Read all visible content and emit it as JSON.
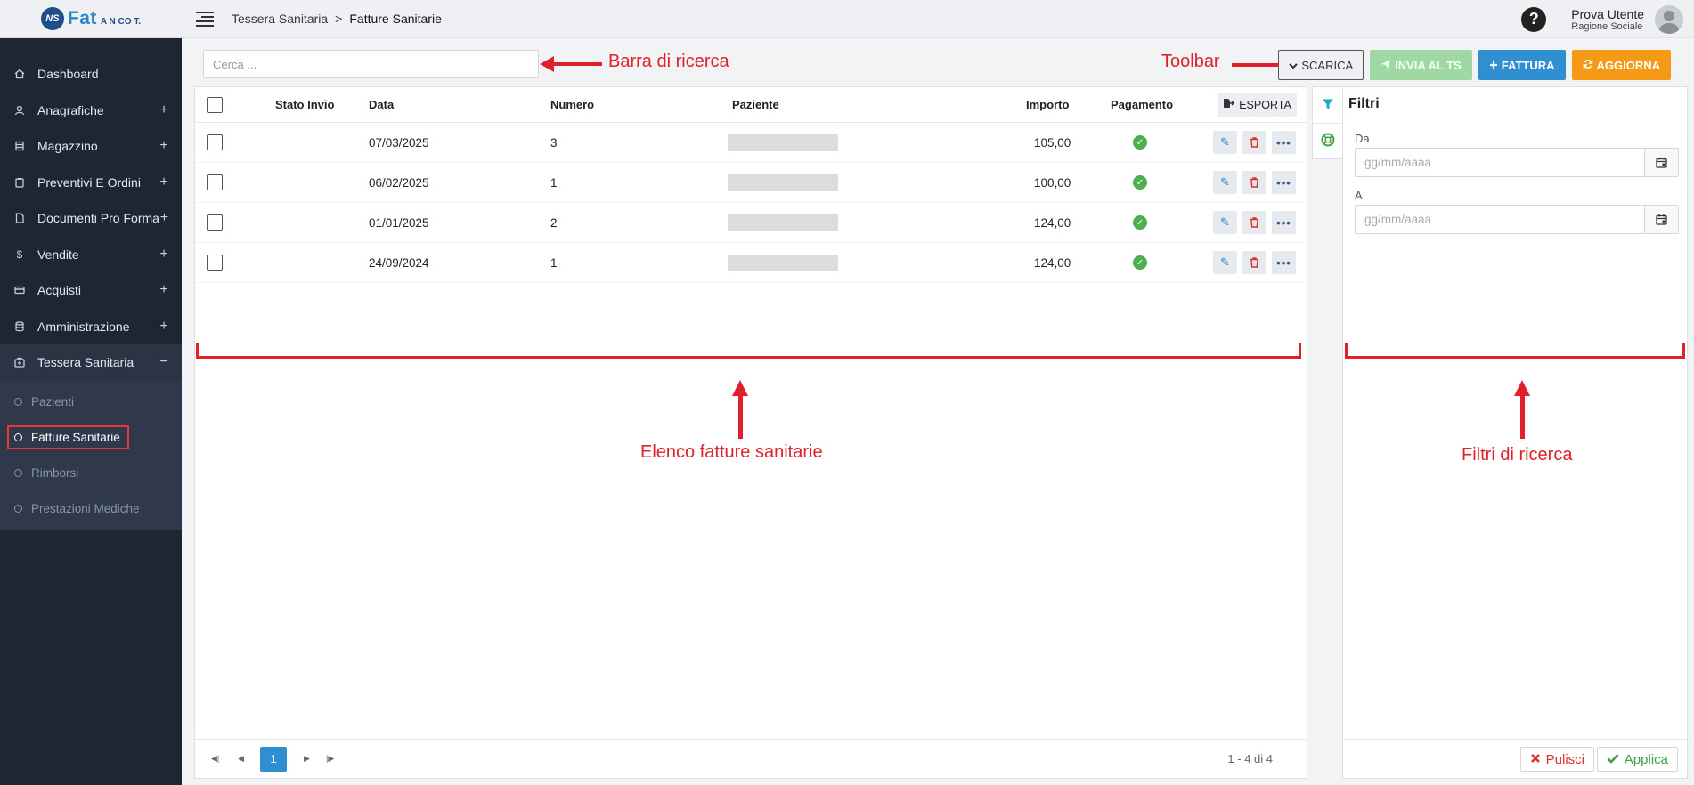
{
  "app": {
    "logo_prefix": "NS",
    "logo_main": "Fat",
    "logo_suffix": "A N CO T."
  },
  "sidebar": {
    "items": [
      {
        "label": "Dashboard",
        "icon": "home-icon",
        "expandable": false
      },
      {
        "label": "Anagrafiche",
        "icon": "user-icon",
        "expandable": true
      },
      {
        "label": "Magazzino",
        "icon": "warehouse-icon",
        "expandable": true
      },
      {
        "label": "Preventivi E Ordini",
        "icon": "clipboard-icon",
        "expandable": true
      },
      {
        "label": "Documenti Pro Forma",
        "icon": "document-icon",
        "expandable": true
      },
      {
        "label": "Vendite",
        "icon": "dollar-icon",
        "expandable": true
      },
      {
        "label": "Acquisti",
        "icon": "credit-card-icon",
        "expandable": true
      },
      {
        "label": "Amministrazione",
        "icon": "database-icon",
        "expandable": true
      },
      {
        "label": "Tessera Sanitaria",
        "icon": "medical-case-icon",
        "expandable": true,
        "expanded": true
      }
    ],
    "plus": "+",
    "minus": "−",
    "subitems": [
      {
        "label": "Pazienti"
      },
      {
        "label": "Fatture Sanitarie",
        "active": true
      },
      {
        "label": "Rimborsi"
      },
      {
        "label": "Prestazioni Mediche"
      }
    ]
  },
  "topbar": {
    "breadcrumb_parent": "Tessera Sanitaria",
    "breadcrumb_sep": ">",
    "breadcrumb_current": "Fatture Sanitarie",
    "help": "?",
    "user_name": "Prova Utente",
    "user_company": "Ragione Sociale"
  },
  "search": {
    "placeholder": "Cerca ..."
  },
  "toolbar": {
    "scarica": "SCARICA",
    "invia": "INVIA AL TS",
    "fattura": "FATTURA",
    "aggiorna": "AGGIORNA"
  },
  "table": {
    "headers": {
      "stato": "Stato Invio",
      "data": "Data",
      "numero": "Numero",
      "paziente": "Paziente",
      "importo": "Importo",
      "pagamento": "Pagamento",
      "esporta": "ESPORTA"
    },
    "rows": [
      {
        "data": "07/03/2025",
        "numero": "3",
        "importo": "105,00"
      },
      {
        "data": "06/02/2025",
        "numero": "1",
        "importo": "100,00"
      },
      {
        "data": "01/01/2025",
        "numero": "2",
        "importo": "124,00"
      },
      {
        "data": "24/09/2024",
        "numero": "1",
        "importo": "124,00"
      }
    ],
    "pager": {
      "current_page": "1",
      "count": "1 - 4 di 4"
    }
  },
  "filters": {
    "title": "Filtri",
    "da_label": "Da",
    "a_label": "A",
    "date_placeholder": "gg/mm/aaaa",
    "pulisci": "Pulisci",
    "applica": "Applica"
  },
  "annotations": {
    "search_bar": "Barra di ricerca",
    "toolbar": "Toolbar",
    "invoice_list": "Elenco fatture sanitarie",
    "search_filters": "Filtri di ricerca"
  },
  "colors": {
    "sidebar_bg": "#1f2633",
    "accent_blue": "#2f8fd0",
    "accent_orange": "#f59a15",
    "accent_green_light": "#9fd8a3",
    "annotation_red": "#e0202a"
  }
}
